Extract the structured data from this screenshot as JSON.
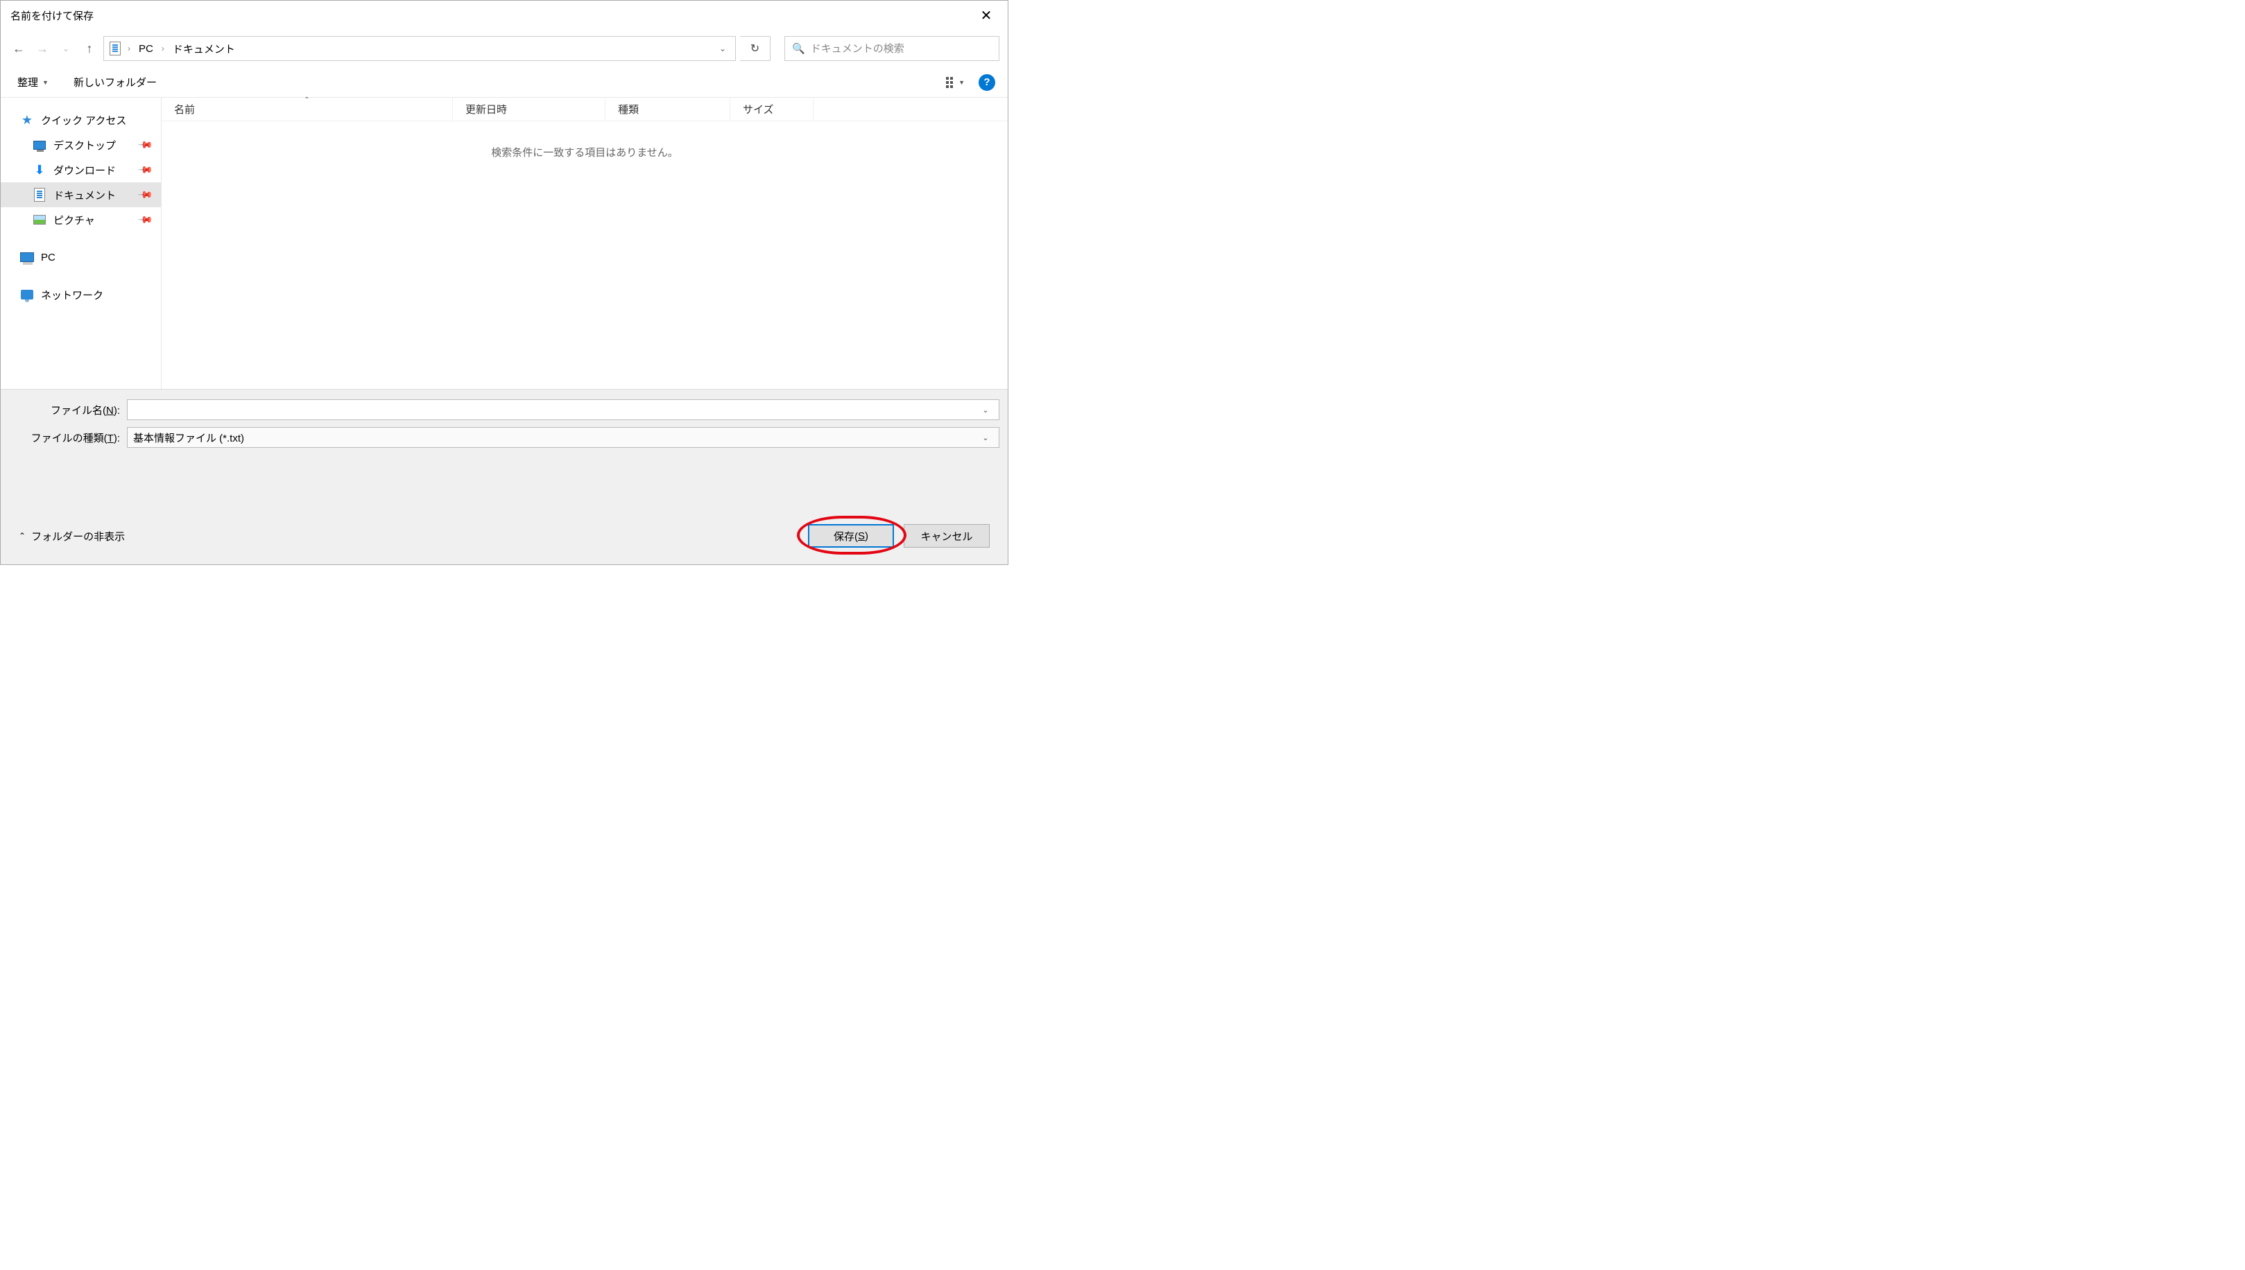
{
  "title": "名前を付けて保存",
  "breadcrumb": {
    "root": "PC",
    "current": "ドキュメント"
  },
  "search": {
    "placeholder": "ドキュメントの検索"
  },
  "toolbar": {
    "organize": "整理",
    "newfolder": "新しいフォルダー"
  },
  "sidebar": {
    "quickaccess": "クイック アクセス",
    "desktop": "デスクトップ",
    "downloads": "ダウンロード",
    "documents": "ドキュメント",
    "pictures": "ピクチャ",
    "pc": "PC",
    "network": "ネットワーク"
  },
  "columns": {
    "name": "名前",
    "date": "更新日時",
    "type": "種類",
    "size": "サイズ"
  },
  "empty_message": "検索条件に一致する項目はありません。",
  "fields": {
    "filename_label_pre": "ファイル名(",
    "filename_label_key": "N",
    "filename_label_post": "):",
    "filename_value": "",
    "filetype_label_pre": "ファイルの種類(",
    "filetype_label_key": "T",
    "filetype_label_post": "):",
    "filetype_value": "基本情報ファイル (*.txt)"
  },
  "footer": {
    "hide_folders": "フォルダーの非表示",
    "save_pre": "保存(",
    "save_key": "S",
    "save_post": ")",
    "cancel": "キャンセル"
  }
}
